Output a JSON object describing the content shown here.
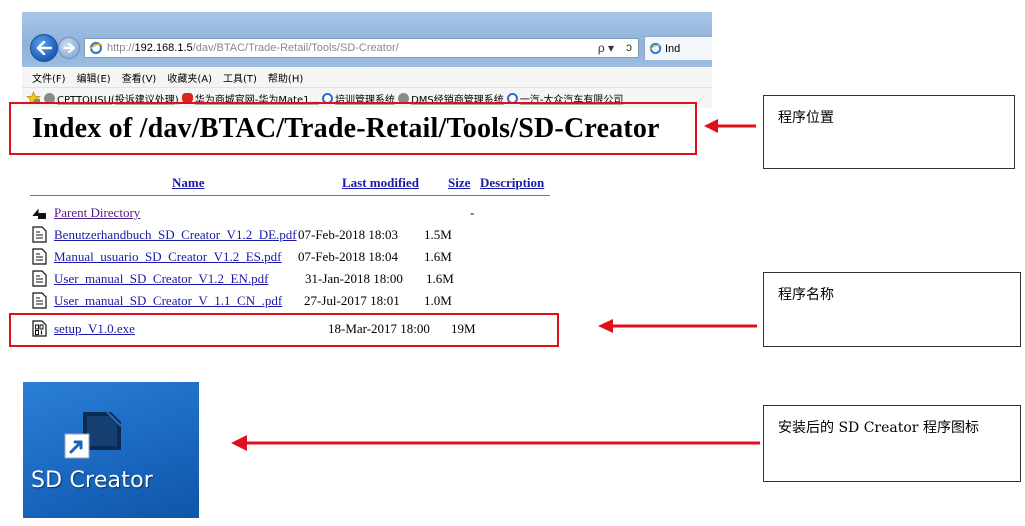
{
  "browser": {
    "url_prefix": "http://",
    "url_host": "192.168.1.5",
    "url_path": "/dav/BTAC/Trade-Retail/Tools/SD-Creator/",
    "search_glyph": "ρ ▾",
    "refresh_glyph": "ↄ",
    "tab_label": "Ind",
    "menu": [
      "文件(F)",
      "编辑(E)",
      "查看(V)",
      "收藏夹(A)",
      "工具(T)",
      "帮助(H)"
    ],
    "favorites": [
      {
        "label": "CPTTOUSU(投诉建议处理)",
        "icon": "globe-icon",
        "color": "#7a7a7a"
      },
      {
        "label": "华为商城官网-华为Mate1...",
        "icon": "huawei-icon",
        "color": "#d9261c"
      },
      {
        "label": "培训管理系统",
        "icon": "ie-page-icon",
        "color": "#2f6fc9"
      },
      {
        "label": "DMS经销商管理系统",
        "icon": "globe-icon",
        "color": "#7a7a7a"
      },
      {
        "label": "一汽-大众汽车有限公司",
        "icon": "ie-page-icon",
        "color": "#2f6fc9"
      }
    ]
  },
  "page": {
    "heading": "Index of /dav/BTAC/Trade-Retail/Tools/SD-Creator",
    "columns": {
      "name": "Name",
      "modified": "Last modified",
      "size": "Size",
      "description": "Description"
    },
    "rows": [
      {
        "name": "Parent Directory",
        "date": "",
        "size": "-",
        "icon": "back-folder-icon"
      },
      {
        "name": "Benutzerhandbuch_SD_Creator_V1.2_DE.pdf",
        "date": "07-Feb-2018 18:03",
        "size": "1.5M",
        "icon": "file-icon"
      },
      {
        "name": "Manual_usuario_SD_Creator_V1.2_ES.pdf",
        "date": "07-Feb-2018 18:04",
        "size": "1.6M",
        "icon": "file-icon"
      },
      {
        "name": "User_manual_SD_Creator_V1.2_EN.pdf",
        "date": "31-Jan-2018 18:00",
        "size": "1.6M",
        "icon": "file-icon"
      },
      {
        "name": "User_manual_SD_Creator_V_1.1_CN_.pdf",
        "date": "27-Jul-2017 18:01",
        "size": "1.0M",
        "icon": "file-icon"
      },
      {
        "name": "setup_V1.0.exe",
        "date": "18-Mar-2017 18:00",
        "size": "19M",
        "icon": "binary-file-icon"
      }
    ]
  },
  "desktop": {
    "shortcut_label": "SD Creator"
  },
  "annotations": {
    "location_note": "程序位置",
    "name_note": "程序名称",
    "icon_note": "安装后的 SD Creator 程序图标"
  },
  "colors": {
    "annotation_red": "#e0101a",
    "link_blue": "#1a1aa6",
    "desktop_blue": "#1d6cc5"
  }
}
